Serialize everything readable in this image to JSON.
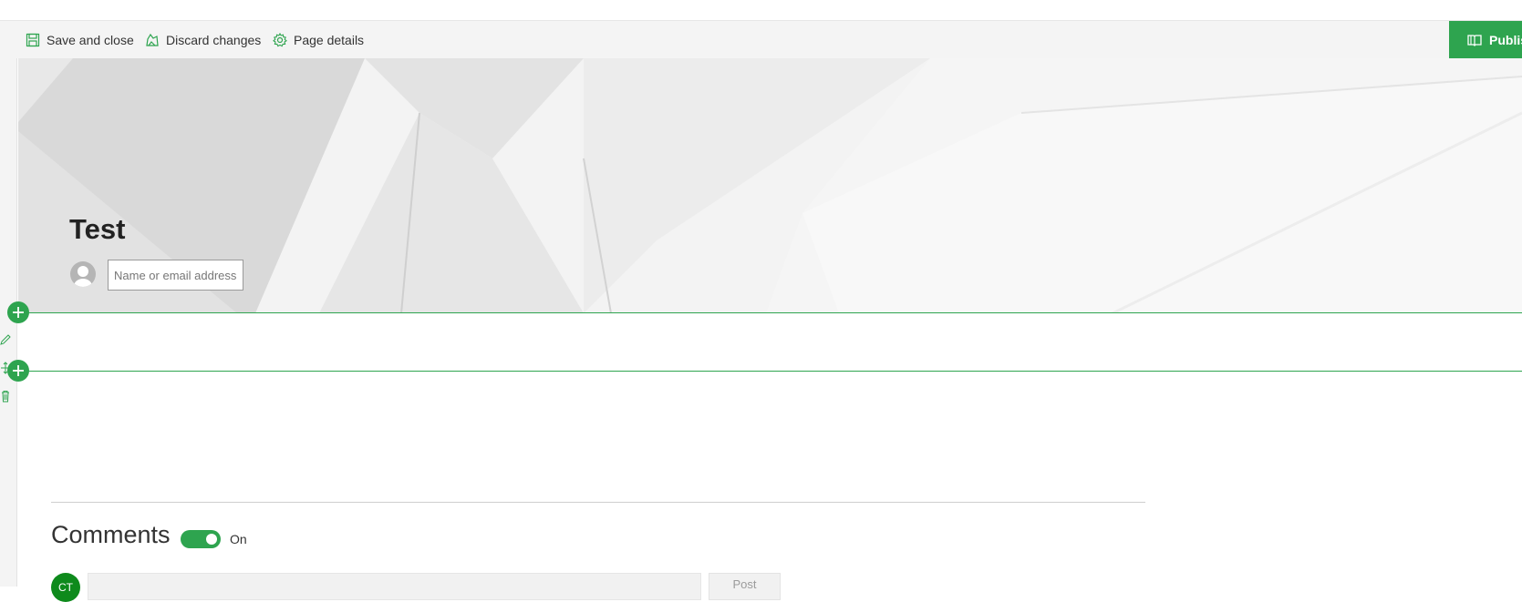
{
  "toolbar": {
    "save_label": "Save and close",
    "discard_label": "Discard changes",
    "details_label": "Page details",
    "publish_label": "Publish"
  },
  "hero": {
    "title": "Test",
    "author_placeholder": "Name or email address"
  },
  "comments": {
    "title": "Comments",
    "toggle_label": "On",
    "toggle_on": true,
    "user_initials": "CT",
    "post_label": "Post"
  },
  "colors": {
    "accent": "#2ea44f",
    "avatar": "#0e8a1c",
    "toolbar_bg": "#f4f4f4"
  }
}
